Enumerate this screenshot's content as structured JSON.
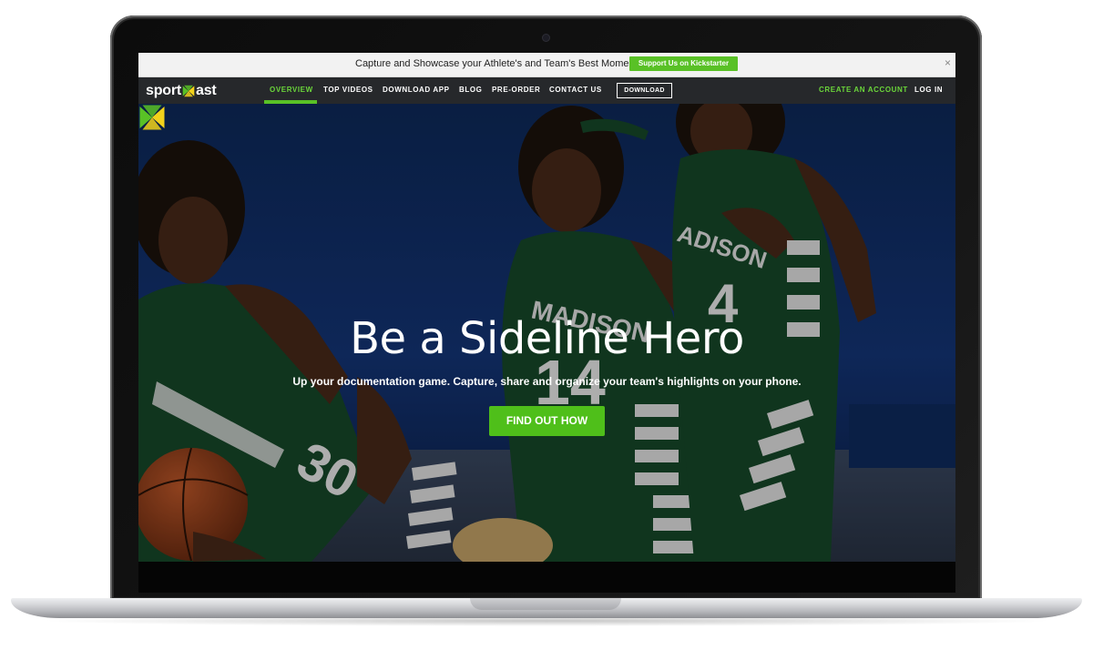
{
  "banner": {
    "text": "Capture and Showcase your Athlete's and Team's Best Moments",
    "button_label": "Support Us on Kickstarter",
    "close": "×"
  },
  "nav": {
    "logo_left": "sport",
    "logo_right": "ast",
    "items": [
      {
        "label": "OVERVIEW",
        "active": true
      },
      {
        "label": "TOP VIDEOS"
      },
      {
        "label": "DOWNLOAD APP"
      },
      {
        "label": "BLOG"
      },
      {
        "label": "PRE-ORDER"
      },
      {
        "label": "CONTACT US"
      }
    ],
    "download_button": "DOWNLOAD",
    "create_account": "CREATE AN ACCOUNT",
    "login": "LOG IN"
  },
  "hero": {
    "title": "Be a Sideline Hero",
    "subtitle": "Up your documentation game. Capture, share and organize your team's highlights on your phone.",
    "cta": "FIND OUT HOW",
    "jersey_numbers": [
      "30",
      "14",
      "4"
    ],
    "jersey_text": [
      "MADISON",
      "MADISON",
      "ADISON"
    ]
  },
  "colors": {
    "accent_green": "#59c126",
    "logo_yellow": "#f2d21b",
    "nav_bg": "#26282b",
    "jersey_green": "#174a2a"
  }
}
